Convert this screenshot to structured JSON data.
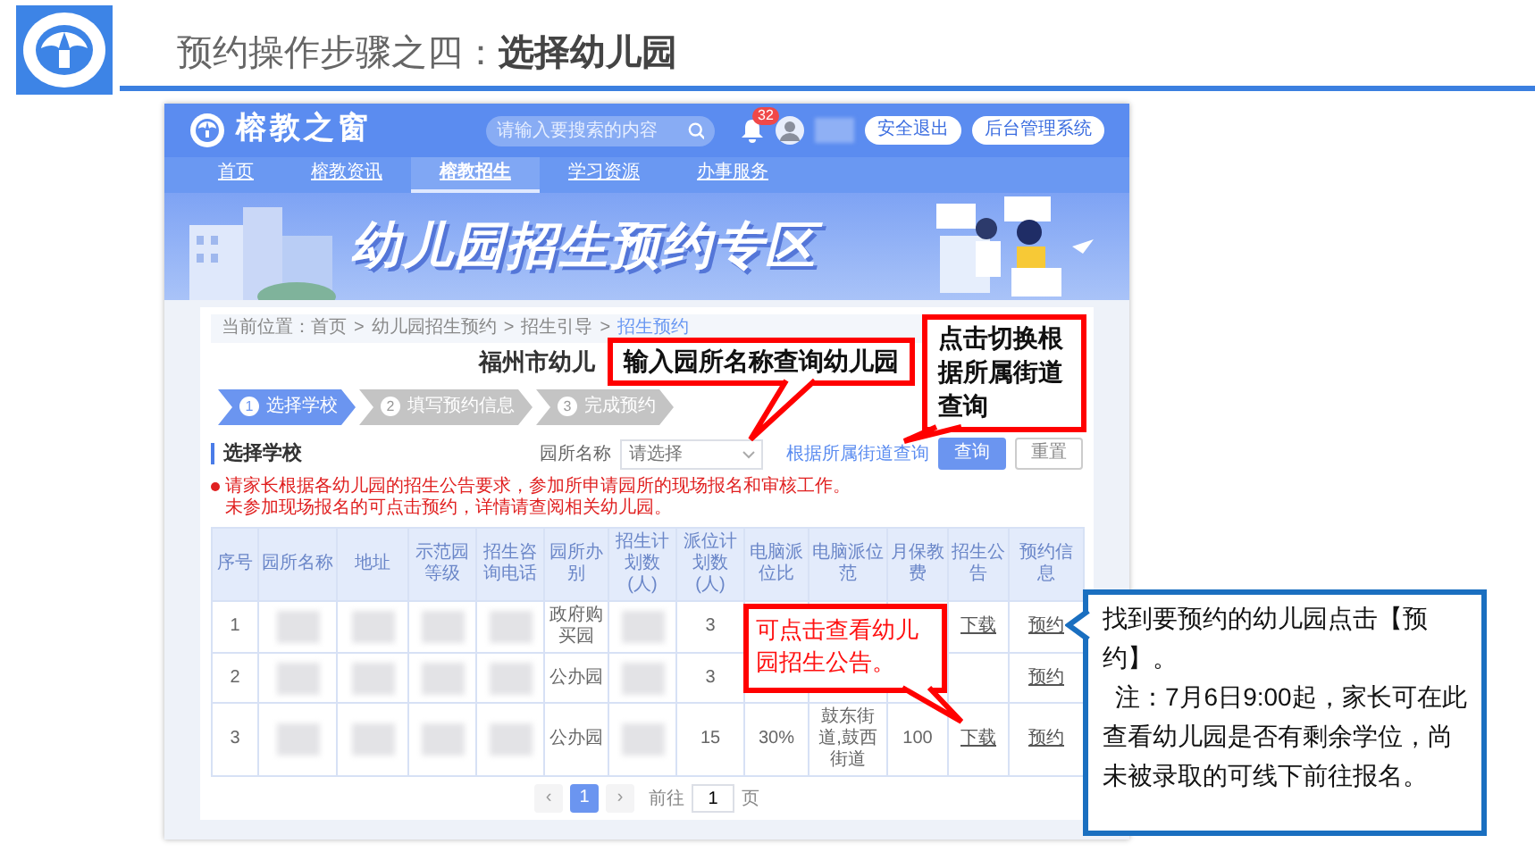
{
  "slide": {
    "title": "预约操作步骤之四：**选择幼儿园**"
  },
  "app": {
    "brand": "榕教之窗",
    "search": {
      "placeholder": "请输入要搜索的内容"
    },
    "notification_count": "32",
    "header_buttons": [
      "安全退出",
      "后台管理系统"
    ],
    "nav": [
      {
        "label": "首页",
        "selected": false
      },
      {
        "label": "榕教资讯",
        "selected": false
      },
      {
        "label": "榕教招生",
        "selected": true
      },
      {
        "label": "学习资源",
        "selected": false
      },
      {
        "label": "办事服务",
        "selected": false
      }
    ],
    "banner": {
      "title": "幼儿园招生预约专区"
    },
    "breadcrumb": {
      "label": "当前位置：",
      "separator": ">",
      "items": [
        {
          "text": "首页",
          "current": false
        },
        {
          "text": "幼儿园招生预约",
          "current": false
        },
        {
          "text": "招生引导",
          "current": false
        },
        {
          "text": "招生预约",
          "current": true
        }
      ]
    },
    "page_title": "福州市幼儿",
    "steps": [
      {
        "number": "1",
        "label": "选择学校",
        "selected": true
      },
      {
        "number": "2",
        "label": "填写预约信息",
        "selected": false
      },
      {
        "number": "3",
        "label": "完成预约",
        "selected": false
      }
    ],
    "section": {
      "title": "选择学校",
      "filter_label": "园所名称",
      "select": {
        "placeholder": "请选择"
      },
      "street_link": "根据所属街道查询",
      "buttons": [
        {
          "label": "查询",
          "kind": "primary"
        },
        {
          "label": "重置",
          "kind": "secondary"
        }
      ]
    },
    "notice": [
      "请家长根据各幼儿园的招生公告要求，参加所申请园所的现场报名和审核工作。",
      "未参加现场报名的可点击预约，详情请查阅相关幼儿园。"
    ],
    "table": {
      "columns": [
        "序号",
        "园所名称",
        "地址",
        "示范园等级",
        "招生咨询电话",
        "园所办别",
        "招生计划数(人)",
        "派位计划数(人)",
        "电脑派位比",
        "电脑派位范",
        "月保教费",
        "招生公告",
        "预约信息"
      ],
      "rows": [
        {
          "cells": [
            {
              "kind": "text",
              "text": "1"
            },
            {
              "kind": "blurred"
            },
            {
              "kind": "blurred"
            },
            {
              "kind": "blurred"
            },
            {
              "kind": "blurred"
            },
            {
              "kind": "text",
              "text": "政府购买园"
            },
            {
              "kind": "blurred"
            },
            {
              "kind": "text",
              "text": "3"
            },
            {
              "kind": "blank"
            },
            {
              "kind": "blank"
            },
            {
              "kind": "blank"
            },
            {
              "kind": "link",
              "text": "下载"
            },
            {
              "kind": "link",
              "text": "预约"
            }
          ]
        },
        {
          "cells": [
            {
              "kind": "text",
              "text": "2"
            },
            {
              "kind": "blurred"
            },
            {
              "kind": "blurred"
            },
            {
              "kind": "blurred"
            },
            {
              "kind": "blurred"
            },
            {
              "kind": "text",
              "text": "公办园"
            },
            {
              "kind": "blurred"
            },
            {
              "kind": "text",
              "text": "3"
            },
            {
              "kind": "blank"
            },
            {
              "kind": "blank"
            },
            {
              "kind": "blank"
            },
            {
              "kind": "blank"
            },
            {
              "kind": "link",
              "text": "预约"
            }
          ]
        },
        {
          "cells": [
            {
              "kind": "text",
              "text": "3"
            },
            {
              "kind": "blurred"
            },
            {
              "kind": "blurred"
            },
            {
              "kind": "blurred"
            },
            {
              "kind": "blurred"
            },
            {
              "kind": "text",
              "text": "公办园"
            },
            {
              "kind": "blurred"
            },
            {
              "kind": "text",
              "text": "15"
            },
            {
              "kind": "text",
              "text": "30%"
            },
            {
              "kind": "text",
              "text": "鼓东街道,鼓西街道"
            },
            {
              "kind": "text",
              "text": "100"
            },
            {
              "kind": "link",
              "text": "下载"
            },
            {
              "kind": "link",
              "text": "预约"
            }
          ]
        }
      ]
    },
    "pagination": {
      "prev": "‹",
      "pages": [
        {
          "label": "1",
          "selected": true
        }
      ],
      "next": "›",
      "goto_label": "前往",
      "goto_value": "1",
      "page_suffix": "页"
    }
  },
  "callouts": [
    {
      "kind": "red",
      "paragraphs": [
        "输入园所名称查询幼儿园"
      ]
    },
    {
      "kind": "red",
      "paragraphs": [
        "点击切换根据所属街道查询"
      ]
    },
    {
      "kind": "red-text",
      "paragraphs": [
        "可点击查看幼儿园招生公告。"
      ]
    },
    {
      "kind": "blue",
      "paragraphs": [
        "找到要预约的幼儿园点击【预约】。",
        "注：7月6日9:00起，家长可在此查看幼儿园是否有剩余学位，尚未被录取的可线下前往报名。"
      ]
    }
  ]
}
